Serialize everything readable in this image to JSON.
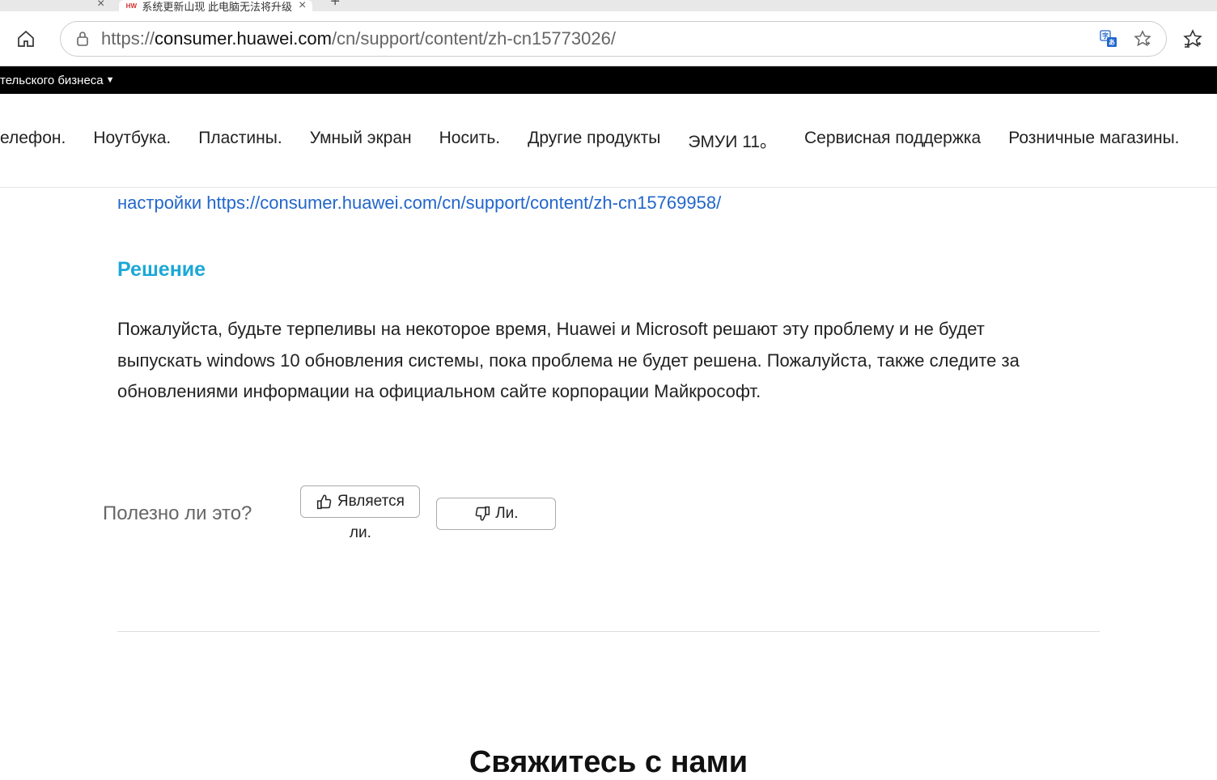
{
  "browser": {
    "tab_title": "系统更新山现 此电脑无法将升级",
    "url_prefix": "https://",
    "url_host": "consumer.huawei.com",
    "url_path": "/cn/support/content/zh-cn15773026/"
  },
  "topbar": {
    "label": "тельского бизнеса"
  },
  "nav": {
    "items": [
      "елефон.",
      "Ноутбука.",
      "Пластины.",
      "Умный экран",
      "Носить.",
      "Другие продукты",
      "ЭМУИ 11。",
      "Сервисная поддержка",
      "Розничные магазины."
    ]
  },
  "article": {
    "partial_link": "настройки  https://consumer.huawei.com/cn/support/content/zh-cn15769958/",
    "solution_heading": "Решение",
    "solution_text": "Пожалуйста, будьте терпеливы на некоторое время, Huawei и Microsoft решают эту проблему и не будет выпускать windows 10 обновления системы, пока проблема не будет решена. Пожалуйста, также следите за обновлениями информации на официальном сайте корпорации Майкрософт."
  },
  "feedback": {
    "question": "Полезно ли это?",
    "yes_label": "Является",
    "yes_below": "ли.",
    "no_label": "Ли."
  },
  "contact": {
    "heading": "Свяжитесь с нами"
  }
}
